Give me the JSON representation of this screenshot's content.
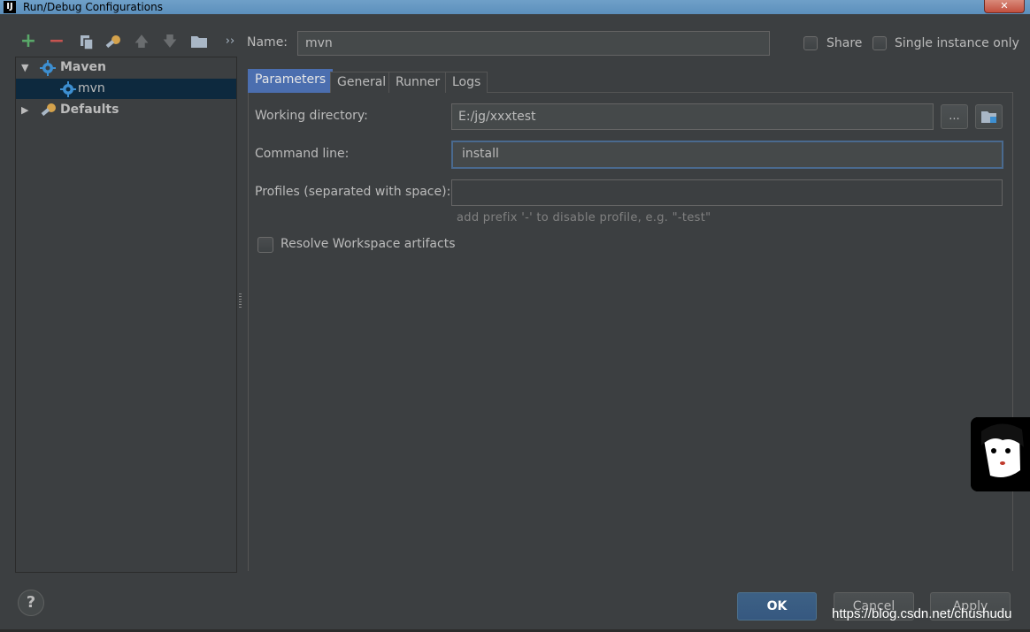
{
  "window": {
    "title": "Run/Debug Configurations",
    "close_glyph": "✕",
    "app_icon_glyph": "IJ"
  },
  "toolbar": {
    "add_glyph": "+",
    "remove_glyph": "−",
    "more_glyph": "››"
  },
  "tree": {
    "items": [
      {
        "label": "Maven",
        "expanded": true,
        "bold": true
      },
      {
        "label": "mvn",
        "selected": true
      },
      {
        "label": "Defaults",
        "expanded": false,
        "bold": true
      }
    ],
    "expanded_glyph": "▼",
    "collapsed_glyph": "▶"
  },
  "header": {
    "name_label": "Name:",
    "name_value": "mvn",
    "share_label": "Share",
    "single_instance_label": "Single instance only"
  },
  "tabs": [
    {
      "label": "Parameters",
      "active": true
    },
    {
      "label": "General",
      "active": false
    },
    {
      "label": "Runner",
      "active": false
    },
    {
      "label": "Logs",
      "active": false
    }
  ],
  "parameters": {
    "working_directory_label": "Working directory:",
    "working_directory_value": "E:/jg/xxxtest",
    "browse_label": "...",
    "command_line_label": "Command line:",
    "command_line_value": "install",
    "profiles_label": "Profiles (separated with space):",
    "profiles_value": "",
    "profiles_hint": "add prefix '-' to disable profile, e.g. \"-test\"",
    "resolve_workspace_label": "Resolve Workspace artifacts"
  },
  "buttons": {
    "help": "?",
    "ok": "OK",
    "cancel": "Cancel",
    "apply": "Apply"
  },
  "watermark": "https://blog.csdn.net/chushudu",
  "colors": {
    "background": "#3c3f41",
    "selection": "#0d293e",
    "tab_active": "#4b6eaf",
    "add_green": "#59a869",
    "remove_red": "#c75450"
  }
}
